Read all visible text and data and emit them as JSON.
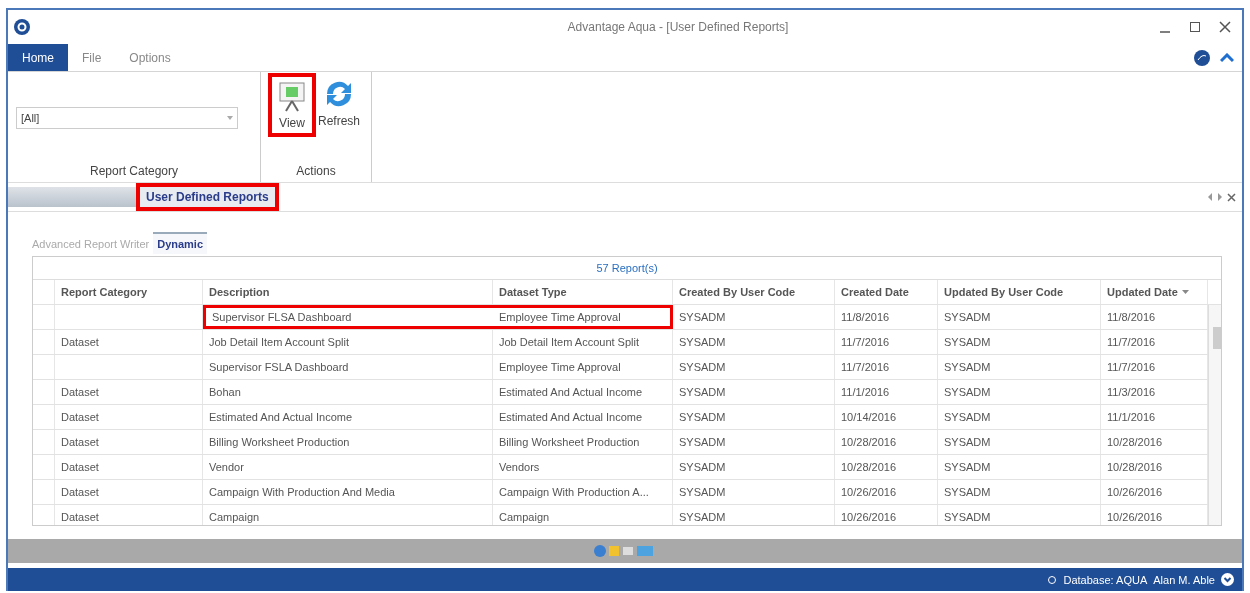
{
  "window": {
    "title": "Advantage Aqua - [User Defined Reports]"
  },
  "ribbon_tabs": [
    {
      "label": "Home",
      "selected": true
    },
    {
      "label": "File",
      "selected": false
    },
    {
      "label": "Options",
      "selected": false
    }
  ],
  "report_category": {
    "value": "[All]",
    "label": "Report Category"
  },
  "actions": {
    "label": "Actions",
    "buttons": [
      {
        "label": "View",
        "kind": "view",
        "highlighted": true
      },
      {
        "label": "Refresh",
        "kind": "refresh",
        "highlighted": false
      }
    ]
  },
  "dock_tab": {
    "label": "User Defined Reports",
    "highlighted": true
  },
  "inner_tabs": [
    {
      "label": "Advanced Report Writer",
      "selected": false
    },
    {
      "label": "Dynamic",
      "selected": true
    }
  ],
  "table": {
    "count": "57 Report(s)",
    "columns": [
      {
        "label": "Report Category",
        "sorted": false
      },
      {
        "label": "Description",
        "sorted": false
      },
      {
        "label": "Dataset Type",
        "sorted": false
      },
      {
        "label": "Created By User Code",
        "sorted": false
      },
      {
        "label": "Created Date",
        "sorted": false
      },
      {
        "label": "Updated By User Code",
        "sorted": false
      },
      {
        "label": "Updated Date",
        "sorted": true
      }
    ],
    "rows": [
      {
        "cells": [
          "",
          "Supervisor FLSA Dashboard",
          "Employee Time Approval",
          "SYSADM",
          "11/8/2016",
          "SYSADM",
          "11/8/2016"
        ],
        "highlighted": true
      },
      {
        "cells": [
          "Dataset",
          "Job Detail Item Account Split",
          "Job Detail Item Account Split",
          "SYSADM",
          "11/7/2016",
          "SYSADM",
          "11/7/2016"
        ],
        "highlighted": false
      },
      {
        "cells": [
          "",
          "Supervisor FSLA Dashboard",
          "Employee Time Approval",
          "SYSADM",
          "11/7/2016",
          "SYSADM",
          "11/7/2016"
        ],
        "highlighted": false
      },
      {
        "cells": [
          "Dataset",
          "Bohan",
          "Estimated And Actual Income",
          "SYSADM",
          "11/1/2016",
          "SYSADM",
          "11/3/2016"
        ],
        "highlighted": false
      },
      {
        "cells": [
          "Dataset",
          "Estimated And Actual Income",
          "Estimated And Actual Income",
          "SYSADM",
          "10/14/2016",
          "SYSADM",
          "11/1/2016"
        ],
        "highlighted": false
      },
      {
        "cells": [
          "Dataset",
          "Billing Worksheet Production",
          "Billing Worksheet Production",
          "SYSADM",
          "10/28/2016",
          "SYSADM",
          "10/28/2016"
        ],
        "highlighted": false
      },
      {
        "cells": [
          "Dataset",
          "Vendor",
          "Vendors",
          "SYSADM",
          "10/28/2016",
          "SYSADM",
          "10/28/2016"
        ],
        "highlighted": false
      },
      {
        "cells": [
          "Dataset",
          "Campaign With Production And Media",
          "Campaign With Production A...",
          "SYSADM",
          "10/26/2016",
          "SYSADM",
          "10/26/2016"
        ],
        "highlighted": false
      },
      {
        "cells": [
          "Dataset",
          "Campaign",
          "Campaign",
          "SYSADM",
          "10/26/2016",
          "SYSADM",
          "10/26/2016"
        ],
        "highlighted": false
      }
    ]
  },
  "status_bar": {
    "database": "Database: AQUA",
    "user": "Alan M. Able"
  }
}
